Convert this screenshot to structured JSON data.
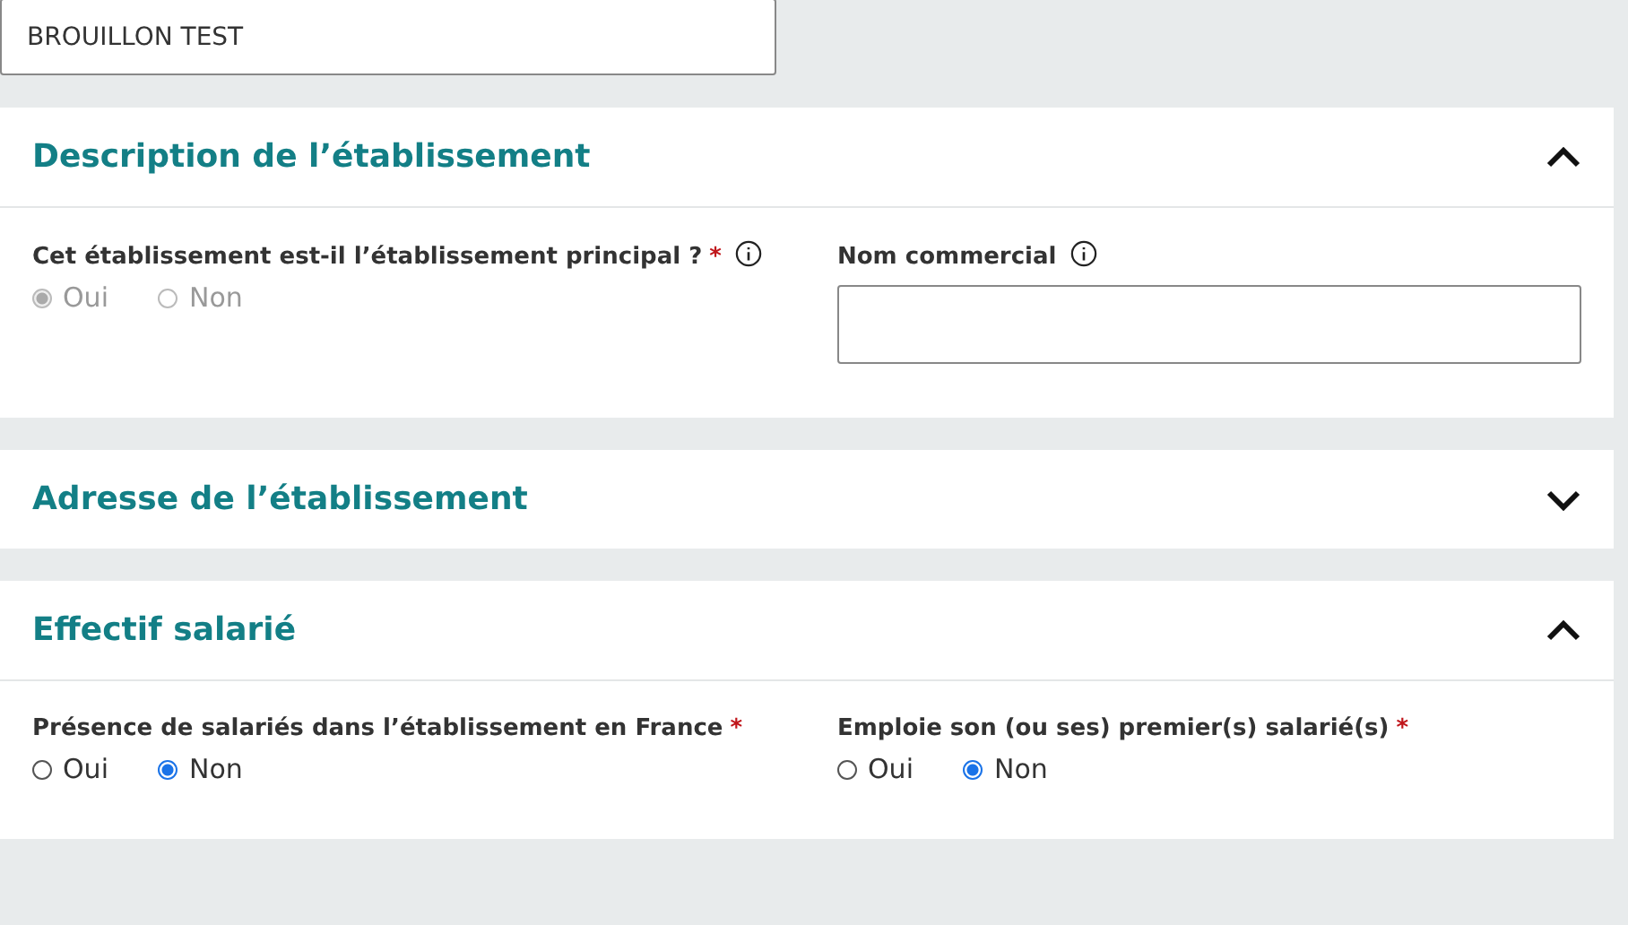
{
  "draft_field": {
    "value": "BROUILLON TEST"
  },
  "sections": [
    {
      "title": "Description de l’établissement",
      "expanded": true,
      "fields": [
        {
          "kind": "radio",
          "label": "Cet établissement est-il l’établissement principal ?",
          "required_mark": "*",
          "info": true,
          "disabled": true,
          "options": [
            {
              "label": "Oui",
              "selected": true
            },
            {
              "label": "Non",
              "selected": false
            }
          ]
        },
        {
          "kind": "text",
          "label": "Nom commercial",
          "info": true
        }
      ]
    },
    {
      "title": "Adresse de l’établissement",
      "expanded": false
    },
    {
      "title": "Effectif salarié",
      "expanded": true,
      "fields": [
        {
          "kind": "radio",
          "label": "Présence de salariés dans l’établissement en France",
          "required_mark": "*",
          "info": false,
          "disabled": false,
          "options": [
            {
              "label": "Oui",
              "selected": false
            },
            {
              "label": "Non",
              "selected": true
            }
          ]
        },
        {
          "kind": "radio",
          "label": "Emploie son (ou ses) premier(s) salarié(s)",
          "required_mark": "*",
          "info": false,
          "disabled": false,
          "options": [
            {
              "label": "Oui",
              "selected": false
            },
            {
              "label": "Non",
              "selected": true
            }
          ]
        }
      ]
    }
  ]
}
